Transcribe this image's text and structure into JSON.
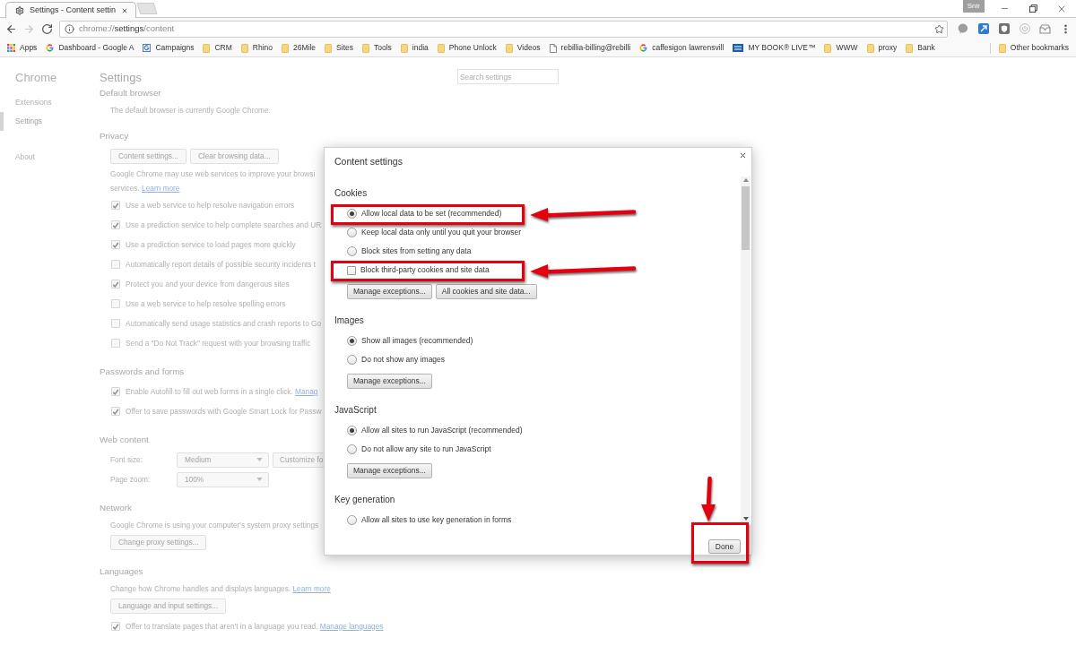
{
  "browser": {
    "tabs": [
      {
        "title": "Settings - Content settin",
        "selected": true
      }
    ],
    "profile": "Snir",
    "nav_buttons": [
      {
        "kind": "back",
        "disabled": false
      },
      {
        "kind": "forward",
        "disabled": true
      },
      {
        "kind": "reload",
        "disabled": false
      }
    ],
    "address": {
      "scheme": "chrome://",
      "host": "settings",
      "path": "/content"
    },
    "bookmarks": [
      {
        "kind": "apps",
        "label": "Apps"
      },
      {
        "kind": "google",
        "label": "Dashboard - Google A"
      },
      {
        "kind": "campaigns",
        "label": "Campaigns"
      },
      {
        "kind": "folder",
        "label": "CRM"
      },
      {
        "kind": "folder",
        "label": "Rhino"
      },
      {
        "kind": "folder",
        "label": "26Mile"
      },
      {
        "kind": "folder",
        "label": "Sites"
      },
      {
        "kind": "folder",
        "label": "Tools"
      },
      {
        "kind": "folder",
        "label": "india"
      },
      {
        "kind": "folder",
        "label": "Phone Unlock"
      },
      {
        "kind": "folder",
        "label": "Videos"
      },
      {
        "kind": "page",
        "label": "rebillia-billing@rebilli"
      },
      {
        "kind": "google",
        "label": "caffesigon lawrensvill"
      },
      {
        "kind": "drive",
        "label": "MY BOOK® LIVE™"
      },
      {
        "kind": "folder",
        "label": "WWW"
      },
      {
        "kind": "folder",
        "label": "proxy"
      },
      {
        "kind": "folder",
        "label": "Bank"
      }
    ],
    "other_bookmarks": "Other bookmarks"
  },
  "settings": {
    "nav_title": "Chrome",
    "nav_groups": [
      {
        "items": [
          {
            "label": "Extensions",
            "selected": false
          },
          {
            "label": "Settings",
            "selected": true
          }
        ]
      },
      {
        "items": [
          {
            "label": "About",
            "selected": false
          }
        ]
      }
    ],
    "title": "Settings",
    "search": {
      "placeholder": "Search settings"
    },
    "sections": [
      {
        "heading": "Default browser",
        "items": [
          {
            "kind": "text",
            "text": "The default browser is currently Google Chrome."
          }
        ]
      },
      {
        "heading": "Privacy",
        "items": [
          {
            "kind": "buttons",
            "buttons": [
              "Content settings...",
              "Clear browsing data..."
            ]
          },
          {
            "kind": "text",
            "text": "Google Chrome may use web services to improve your browsi"
          },
          {
            "kind": "text",
            "text": "services.",
            "link": "Learn more"
          },
          {
            "kind": "checkbox",
            "label": "Use a web service to help resolve navigation errors",
            "checked": true
          },
          {
            "kind": "checkbox",
            "label": "Use a prediction service to help complete searches and UR",
            "checked": true
          },
          {
            "kind": "checkbox",
            "label": "Use a prediction service to load pages more quickly",
            "checked": true
          },
          {
            "kind": "checkbox",
            "label": "Automatically report details of possible security incidents t",
            "checked": false
          },
          {
            "kind": "checkbox",
            "label": "Protect you and your device from dangerous sites",
            "checked": true
          },
          {
            "kind": "checkbox",
            "label": "Use a web service to help resolve spelling errors",
            "checked": false
          },
          {
            "kind": "checkbox",
            "label": "Automatically send usage statistics and crash reports to Go",
            "checked": false
          },
          {
            "kind": "checkbox",
            "label": "Send a \"Do Not Track\" request with your browsing traffic",
            "checked": false
          }
        ]
      },
      {
        "heading": "Passwords and forms",
        "items": [
          {
            "kind": "checkbox",
            "label": "Enable Autofill to fill out web forms in a single click.",
            "link": "Manag",
            "checked": true
          },
          {
            "kind": "checkbox",
            "label": "Offer to save passwords with Google Smart Lock for Passw",
            "checked": true
          }
        ]
      },
      {
        "heading": "Web content",
        "items": [
          {
            "kind": "select",
            "label": "Font size:",
            "value": "Medium",
            "button": "Customize fo"
          },
          {
            "kind": "select",
            "label": "Page zoom:",
            "value": "100%"
          }
        ]
      },
      {
        "heading": "Network",
        "items": [
          {
            "kind": "text",
            "text": "Google Chrome is using your computer's system proxy settings"
          },
          {
            "kind": "buttons",
            "buttons": [
              "Change proxy settings..."
            ]
          }
        ]
      },
      {
        "heading": "Languages",
        "items": [
          {
            "kind": "text",
            "text": "Change how Chrome handles and displays languages.",
            "link": "Learn more"
          },
          {
            "kind": "buttons",
            "buttons": [
              "Language and input settings..."
            ]
          },
          {
            "kind": "checkbox",
            "label": "Offer to translate pages that aren't in a language you read.",
            "link": "Manage languages",
            "checked": true
          }
        ]
      }
    ]
  },
  "dialog": {
    "title": "Content settings",
    "sections": [
      {
        "heading": "Cookies",
        "items": [
          {
            "kind": "radio",
            "label": "Allow local data to be set (recommended)",
            "selected": true,
            "highlighted": true
          },
          {
            "kind": "radio",
            "label": "Keep local data only until you quit your browser",
            "selected": false,
            "highlighted": false
          },
          {
            "kind": "radio",
            "label": "Block sites from setting any data",
            "selected": false,
            "highlighted": false
          },
          {
            "kind": "checkbox",
            "label": "Block third-party cookies and site data",
            "checked": false,
            "highlighted": true
          },
          {
            "kind": "buttons",
            "buttons": [
              "Manage exceptions...",
              "All cookies and site data..."
            ]
          }
        ]
      },
      {
        "heading": "Images",
        "items": [
          {
            "kind": "radio",
            "label": "Show all images (recommended)",
            "selected": true,
            "highlighted": false
          },
          {
            "kind": "radio",
            "label": "Do not show any images",
            "selected": false,
            "highlighted": false
          },
          {
            "kind": "buttons",
            "buttons": [
              "Manage exceptions..."
            ]
          }
        ]
      },
      {
        "heading": "JavaScript",
        "items": [
          {
            "kind": "radio",
            "label": "Allow all sites to run JavaScript (recommended)",
            "selected": true,
            "highlighted": false
          },
          {
            "kind": "radio",
            "label": "Do not allow any site to run JavaScript",
            "selected": false,
            "highlighted": false
          },
          {
            "kind": "buttons",
            "buttons": [
              "Manage exceptions..."
            ]
          }
        ]
      },
      {
        "heading": "Key generation",
        "items": [
          {
            "kind": "radio",
            "label": "Allow all sites to use key generation in forms",
            "selected": false,
            "highlighted": false
          }
        ]
      }
    ],
    "done": {
      "label": "Done",
      "highlighted": true
    }
  }
}
